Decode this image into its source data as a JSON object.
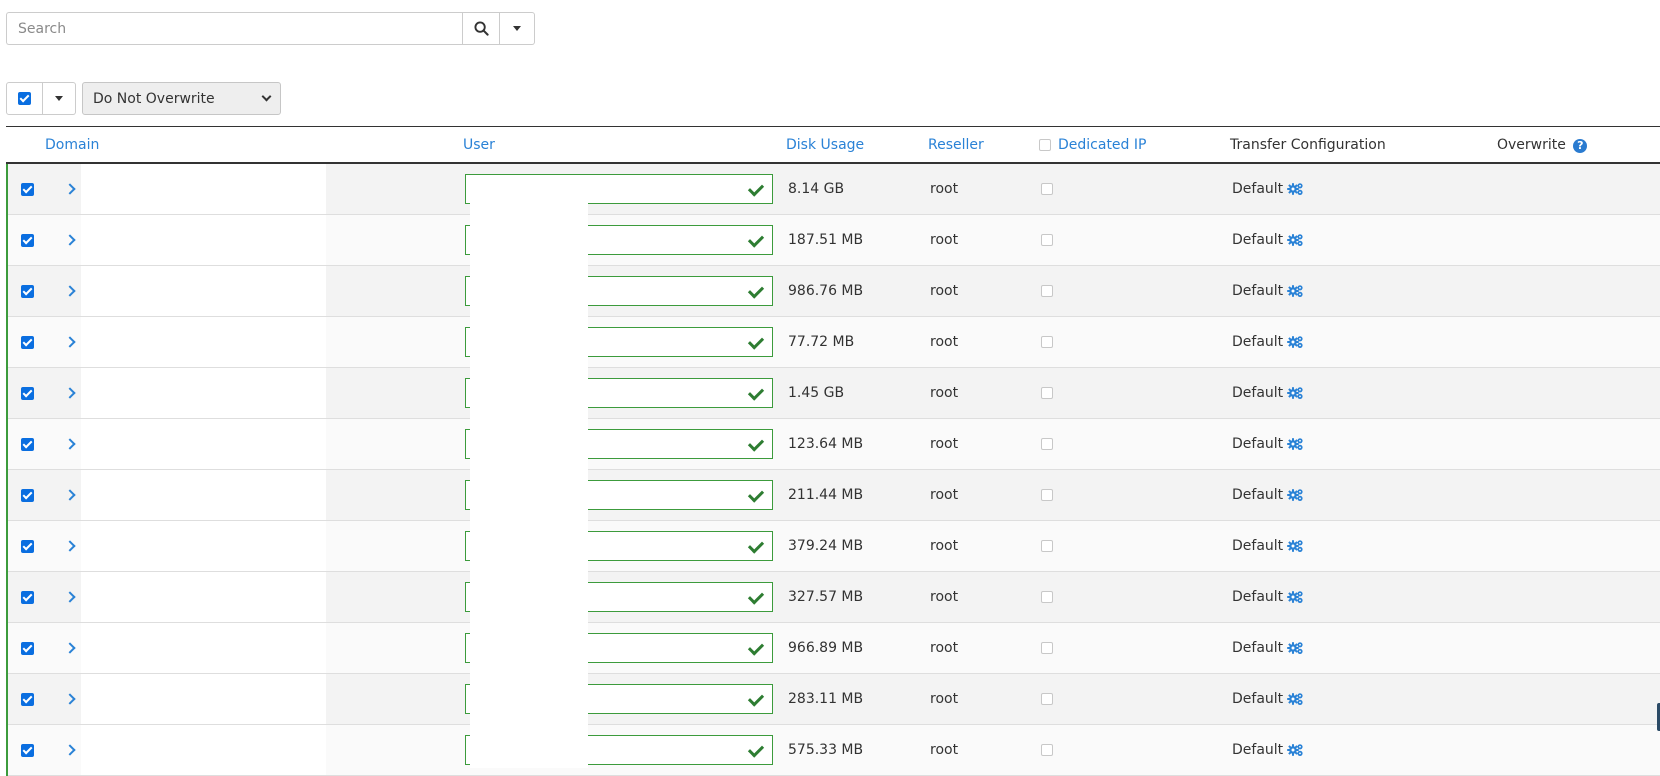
{
  "search": {
    "placeholder": "Search"
  },
  "toolbar": {
    "overwrite_selected": "Do Not Overwrite"
  },
  "columns": {
    "domain": "Domain",
    "user": "User",
    "disk_usage": "Disk Usage",
    "reseller": "Reseller",
    "dedicated_ip": "Dedicated IP",
    "transfer_configuration": "Transfer Configuration",
    "overwrite": "Overwrite"
  },
  "rows": [
    {
      "disk_usage": "8.14 GB",
      "reseller": "root",
      "transfer": "Default"
    },
    {
      "disk_usage": "187.51 MB",
      "reseller": "root",
      "transfer": "Default"
    },
    {
      "disk_usage": "986.76 MB",
      "reseller": "root",
      "transfer": "Default"
    },
    {
      "disk_usage": "77.72 MB",
      "reseller": "root",
      "transfer": "Default"
    },
    {
      "disk_usage": "1.45 GB",
      "reseller": "root",
      "transfer": "Default"
    },
    {
      "disk_usage": "123.64 MB",
      "reseller": "root",
      "transfer": "Default"
    },
    {
      "disk_usage": "211.44 MB",
      "reseller": "root",
      "transfer": "Default"
    },
    {
      "disk_usage": "379.24 MB",
      "reseller": "root",
      "transfer": "Default"
    },
    {
      "disk_usage": "327.57 MB",
      "reseller": "root",
      "transfer": "Default"
    },
    {
      "disk_usage": "966.89 MB",
      "reseller": "root",
      "transfer": "Default"
    },
    {
      "disk_usage": "283.11 MB",
      "reseller": "root",
      "transfer": "Default"
    },
    {
      "disk_usage": "575.33 MB",
      "reseller": "root",
      "transfer": "Default"
    }
  ],
  "colors": {
    "link": "#2a82d6",
    "valid": "#3c9b3c",
    "checkbox": "#0a6ee0"
  }
}
